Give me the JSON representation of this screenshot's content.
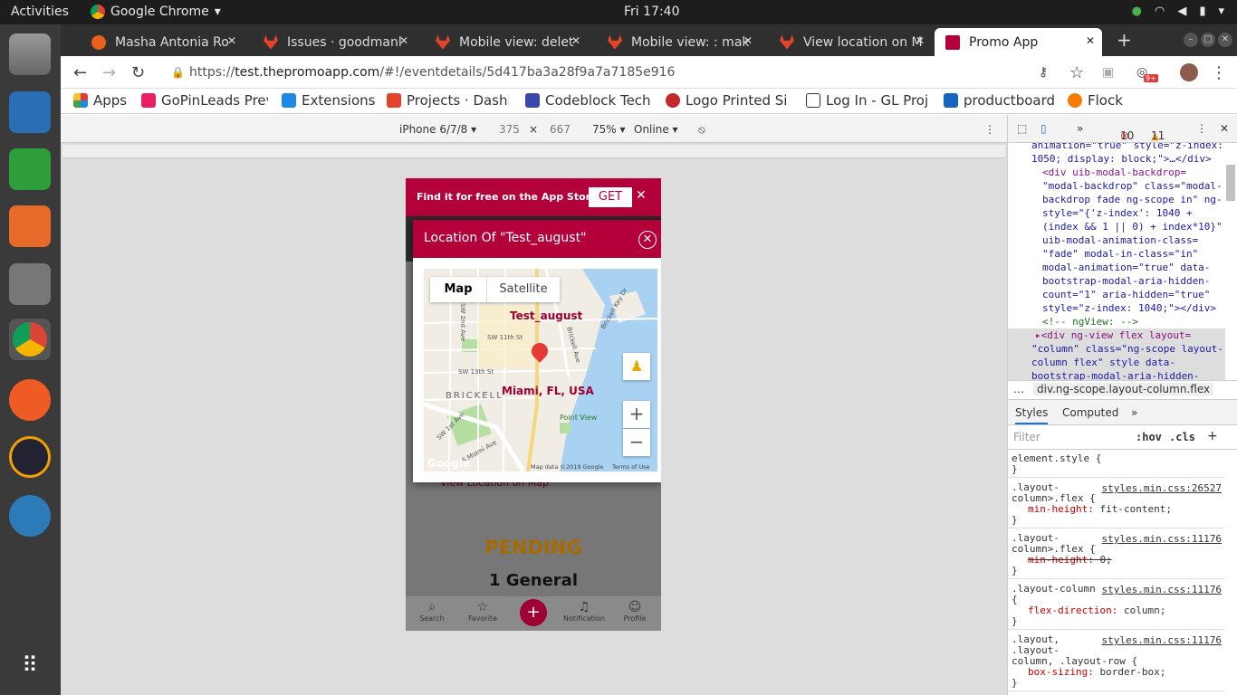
{
  "system": {
    "activities": "Activities",
    "app": "Google Chrome",
    "clock": "Fri 17:40"
  },
  "tabs": [
    {
      "label": "Masha Antonia Ro",
      "color": "#e8601c"
    },
    {
      "label": "Issues · goodmanl",
      "color": "#e24329"
    },
    {
      "label": "Mobile view: delet",
      "color": "#e24329"
    },
    {
      "label": "Mobile view: : mak",
      "color": "#e24329"
    },
    {
      "label": "View location on M",
      "color": "#e24329"
    },
    {
      "label": "Promo App",
      "color": "#b3003b"
    }
  ],
  "toolbar": {
    "url_prefix": "https://",
    "url_host": "test.thepromoapp.com",
    "url_path": "/#!/eventdetails/5d417ba3a28f9a7a7185e916",
    "badge": "9+"
  },
  "bookmarks": [
    {
      "label": "Apps",
      "color": "#e53935"
    },
    {
      "label": "GoPinLeads Prev",
      "color": "#e91e63"
    },
    {
      "label": "Extensions",
      "color": "#1e88e5"
    },
    {
      "label": "Projects · Dashbo",
      "color": "#e24329"
    },
    {
      "label": "Codeblock Techn",
      "color": "#3949ab"
    },
    {
      "label": "Logo Printed Sip",
      "color": "#c62828"
    },
    {
      "label": "Log In - GL Proje",
      "color": "#333333"
    },
    {
      "label": "productboard",
      "color": "#1565c0"
    },
    {
      "label": "Flock",
      "color": "#f57c00"
    }
  ],
  "device": {
    "model": "iPhone 6/7/8 ▾",
    "width": "375",
    "x": "×",
    "height": "667",
    "zoom": "75% ▾",
    "network": "Online ▾"
  },
  "app": {
    "promo_text": "Find it for free on the App Store",
    "get_label": "GET",
    "modal_title": "Location Of \"Test_august\"",
    "map_tab_map": "Map",
    "map_tab_satellite": "Satellite",
    "map_label_event": "Test_august",
    "map_label_city": "Miami, FL, USA",
    "map_data": "Map data ©2019 Google",
    "terms": "Terms of Use",
    "google": "Google",
    "brickell": "BRICKELL",
    "point_view": "Point View",
    "streets": [
      "SW 11th St",
      "SW 13th St",
      "Brickell Key Dr",
      "S Miami Ave",
      "SW 2nd Ave",
      "SW 1st Ave",
      "Brickell Ave"
    ],
    "view_location": "View Location on Map",
    "status": "PENDING",
    "ticket": "1 General",
    "nav": [
      "Search",
      "Favorite",
      "Notification",
      "Profile"
    ]
  },
  "devtools": {
    "errors": "10",
    "warnings": "11",
    "dom_lines": [
      "animation=\"true\" style=\"z-index:",
      "1050; display: block;\">…</div>",
      "<div uib-modal-backdrop=",
      "\"modal-backdrop\" class=\"modal-",
      "backdrop fade ng-scope in\" ng-",
      "style=\"{'z-index': 1040 +",
      "(index && 1 || 0) + index*10}\"",
      "uib-modal-animation-class=",
      "\"fade\" modal-in-class=\"in\"",
      "modal-animation=\"true\" data-",
      "bootstrap-modal-aria-hidden-",
      "count=\"1\" aria-hidden=\"true\"",
      "style=\"z-index: 1040;\"></div>",
      "<!-- ngView: -->",
      "▸<div ng-view flex layout=",
      "\"column\" class=\"ng-scope layout-",
      "column flex\" style data-",
      "bootstrap-modal-aria-hidden-"
    ],
    "breadcrumb": "div.ng-scope.layout-column.flex",
    "tab_styles": "Styles",
    "tab_computed": "Computed",
    "filter_placeholder": "Filter",
    "hov": ":hov",
    "cls": ".cls",
    "rules": [
      {
        "sel": "element.style {",
        "src": "",
        "props": []
      },
      {
        "sel": ".layout-\ncolumn>.flex {",
        "src": "styles.min.css:26527",
        "props": [
          "min-height: fit-content;"
        ]
      },
      {
        "sel": ".layout-\ncolumn>.flex {",
        "src": "styles.min.css:11176",
        "props": [
          "min-height: 0;"
        ]
      },
      {
        "sel": ".layout-column\n{",
        "src": "styles.min.css:11176",
        "props": [
          "flex-direction: column;"
        ]
      },
      {
        "sel": ".layout,\n.layout-\ncolumn, .layout-row {",
        "src": "styles.min.css:11176",
        "props": [
          "box-sizing: border-box;"
        ]
      }
    ]
  }
}
